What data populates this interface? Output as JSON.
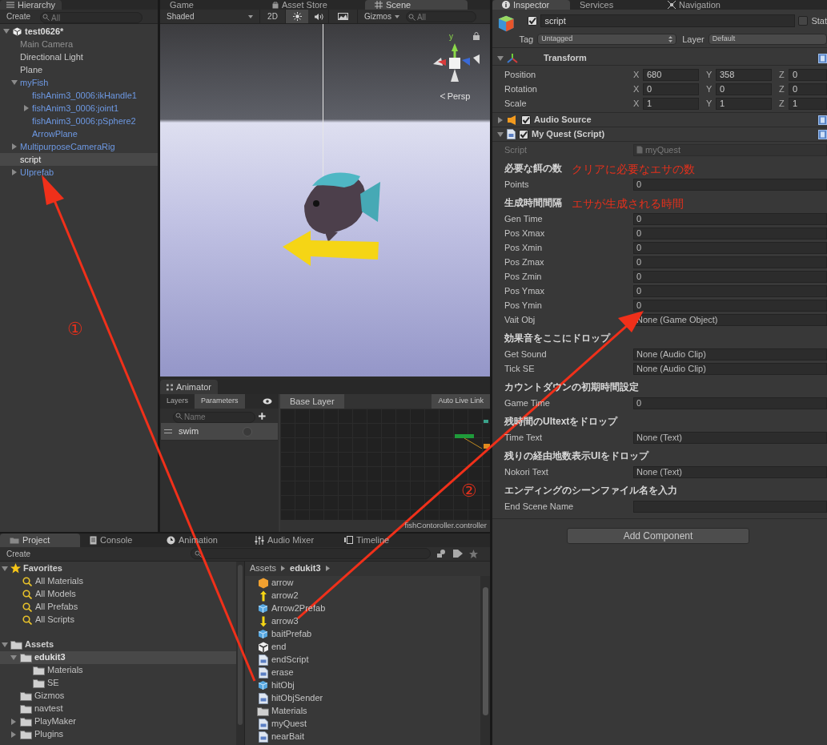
{
  "hierarchy": {
    "tab": "Hierarchy",
    "create": "Create",
    "search_placeholder": "All",
    "scene": "test0626*",
    "items": [
      {
        "label": "Main Camera",
        "kind": "object",
        "disabled": true,
        "selected": false
      },
      {
        "label": "Directional Light",
        "kind": "object",
        "disabled": false,
        "selected": false
      },
      {
        "label": "Plane",
        "kind": "object",
        "disabled": false,
        "selected": false
      },
      {
        "label": "myFish",
        "kind": "prefab",
        "disabled": false,
        "expanded": true,
        "selected": false,
        "children": [
          {
            "label": "fishAnim3_0006:ikHandle1",
            "kind": "prefab",
            "disabled": false,
            "selected": false
          },
          {
            "label": "fishAnim3_0006:joint1",
            "kind": "prefab",
            "disabled": false,
            "expanded": false,
            "selected": false
          },
          {
            "label": "fishAnim3_0006:pSphere2",
            "kind": "prefab",
            "disabled": false,
            "selected": false
          },
          {
            "label": "ArrowPlane",
            "kind": "prefab",
            "disabled": false,
            "selected": false
          }
        ]
      },
      {
        "label": "MultipurposeCameraRig",
        "kind": "prefab",
        "disabled": false,
        "expanded": false,
        "selected": false
      },
      {
        "label": "script",
        "kind": "object",
        "disabled": false,
        "selected": true
      },
      {
        "label": "UIprefab",
        "kind": "prefab",
        "disabled": false,
        "expanded": false,
        "selected": false
      }
    ]
  },
  "scene": {
    "tabs": [
      {
        "label": "Game",
        "selected": false
      },
      {
        "label": "Asset Store",
        "selected": false
      },
      {
        "label": "Scene",
        "selected": true
      }
    ],
    "shading": "Shaded",
    "mode_2d": "2D",
    "lighting_on": true,
    "audio_on": false,
    "gizmos": "Gizmos",
    "search_placeholder": "All",
    "gizmo_axis": "y",
    "projection": "Persp"
  },
  "animator": {
    "tab": "Animator",
    "tabs": [
      {
        "label": "Layers",
        "selected": false
      },
      {
        "label": "Parameters",
        "selected": true
      }
    ],
    "search_placeholder": "Name",
    "layer": "Base Layer",
    "live_link": "Auto Live Link",
    "parameters": [
      {
        "name": "swim",
        "value": false
      }
    ],
    "footer": "fishContoroller.controller"
  },
  "inspector": {
    "tabs": [
      {
        "label": "Inspector",
        "selected": true
      },
      {
        "label": "Services",
        "selected": false
      },
      {
        "label": "Navigation",
        "selected": false
      }
    ],
    "object": {
      "active": true,
      "name": "script",
      "static_label": "Stat",
      "static": false,
      "tag_label": "Tag",
      "tag": "Untagged",
      "layer_label": "Layer",
      "layer": "Default"
    },
    "transform": {
      "title": "Transform",
      "expanded": true,
      "rows": [
        {
          "label": "Position",
          "cells": [
            {
              "axis": "X",
              "value": "680"
            },
            {
              "axis": "Y",
              "value": "358"
            },
            {
              "axis": "Z",
              "value": "0"
            }
          ]
        },
        {
          "label": "Rotation",
          "cells": [
            {
              "axis": "X",
              "value": "0"
            },
            {
              "axis": "Y",
              "value": "0"
            },
            {
              "axis": "Z",
              "value": "0"
            }
          ]
        },
        {
          "label": "Scale",
          "cells": [
            {
              "axis": "X",
              "value": "1"
            },
            {
              "axis": "Y",
              "value": "1"
            },
            {
              "axis": "Z",
              "value": "1"
            }
          ]
        }
      ]
    },
    "components": [
      {
        "kind": "audio",
        "title": "Audio Source",
        "enabled": true,
        "expanded": false
      },
      {
        "kind": "script",
        "title": "My Quest (Script)",
        "enabled": true,
        "expanded": true
      }
    ],
    "script_label": "Script",
    "script_value": "myQuest",
    "fields": [
      {
        "kind": "header",
        "label": "必要な餌の数",
        "note": "クリアに必要なエサの数"
      },
      {
        "kind": "field",
        "label": "Points",
        "value": "0"
      },
      {
        "kind": "header",
        "label": "生成時間間隔",
        "note": "エサが生成される時間"
      },
      {
        "kind": "field",
        "label": "Gen Time",
        "value": "0"
      },
      {
        "kind": "field",
        "label": "Pos Xmax",
        "value": "0"
      },
      {
        "kind": "field",
        "label": "Pos Xmin",
        "value": "0"
      },
      {
        "kind": "field",
        "label": "Pos Zmax",
        "value": "0"
      },
      {
        "kind": "field",
        "label": "Pos Zmin",
        "value": "0"
      },
      {
        "kind": "field",
        "label": "Pos Ymax",
        "value": "0"
      },
      {
        "kind": "field",
        "label": "Pos Ymin",
        "value": "0"
      },
      {
        "kind": "field",
        "label": "Vait Obj",
        "value": "None (Game Object)"
      },
      {
        "kind": "header",
        "label": "効果音をここにドロップ"
      },
      {
        "kind": "field",
        "label": "Get Sound",
        "value": "None (Audio Clip)"
      },
      {
        "kind": "field",
        "label": "Tick SE",
        "value": "None (Audio Clip)"
      },
      {
        "kind": "header",
        "label": "カウントダウンの初期時間設定"
      },
      {
        "kind": "field",
        "label": "Game Time",
        "value": "0"
      },
      {
        "kind": "header",
        "label": "残時間のUItextをドロップ"
      },
      {
        "kind": "field",
        "label": "Time Text",
        "value": "None (Text)"
      },
      {
        "kind": "header",
        "label": "残りの経由地数表示UIをドロップ"
      },
      {
        "kind": "field",
        "label": "Nokori Text",
        "value": "None (Text)"
      },
      {
        "kind": "header",
        "label": "エンディングのシーンファイル名を入力"
      },
      {
        "kind": "field",
        "label": "End Scene Name"
      }
    ],
    "add_component": "Add Component"
  },
  "project": {
    "tabs": [
      {
        "label": "Project",
        "kind": "folder",
        "selected": true
      },
      {
        "label": "Console",
        "kind": "console",
        "selected": false
      },
      {
        "label": "Animation",
        "kind": "clock",
        "selected": false
      },
      {
        "label": "Audio Mixer",
        "kind": "mixer",
        "selected": false
      },
      {
        "label": "Timeline",
        "kind": "timeline",
        "selected": false
      }
    ],
    "create": "Create",
    "favorites_label": "Favorites",
    "favorites": [
      "All Materials",
      "All Models",
      "All Prefabs",
      "All Scripts"
    ],
    "assets_label": "Assets",
    "tree": [
      {
        "label": "edukit3",
        "expanded": true,
        "selected": true,
        "children": [
          {
            "label": "Materials",
            "selected": false
          },
          {
            "label": "SE",
            "selected": false
          }
        ]
      },
      {
        "label": "Gizmos",
        "selected": false
      },
      {
        "label": "navtest",
        "selected": false
      },
      {
        "label": "PlayMaker",
        "expanded": false,
        "selected": false
      },
      {
        "label": "Plugins",
        "expanded": false,
        "selected": false
      }
    ],
    "breadcrumb": [
      "Assets",
      "edukit3"
    ],
    "files": [
      {
        "name": "arrow",
        "kind": "material"
      },
      {
        "name": "arrow2",
        "kind": "arrow_up"
      },
      {
        "name": "Arrow2Prefab",
        "kind": "prefab"
      },
      {
        "name": "arrow3",
        "kind": "arrow_down"
      },
      {
        "name": "baitPrefab",
        "kind": "prefab"
      },
      {
        "name": "end",
        "kind": "scene"
      },
      {
        "name": "endScript",
        "kind": "script"
      },
      {
        "name": "erase",
        "kind": "script"
      },
      {
        "name": "hitObj",
        "kind": "prefab"
      },
      {
        "name": "hitObjSender",
        "kind": "script"
      },
      {
        "name": "Materials",
        "kind": "folder"
      },
      {
        "name": "myQuest",
        "kind": "script"
      },
      {
        "name": "nearBait",
        "kind": "script"
      }
    ]
  },
  "annotations": {
    "markers": [
      "①",
      "②"
    ]
  }
}
